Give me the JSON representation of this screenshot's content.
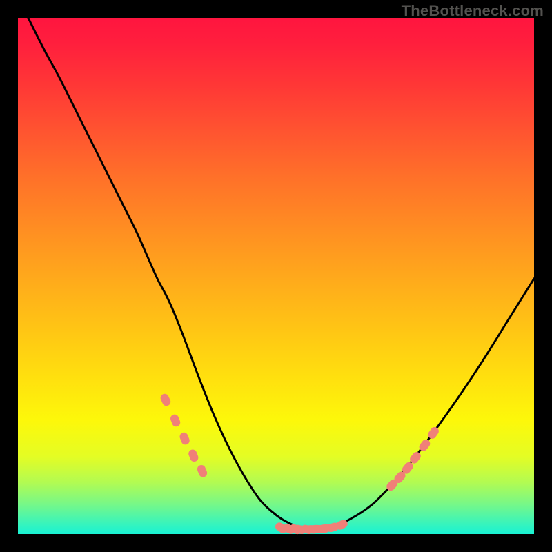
{
  "watermark": "TheBottleneck.com",
  "colors": {
    "background": "#000000",
    "watermark": "#53524f",
    "curve": "#000000",
    "marker_fill": "#f08078",
    "gradient_top": "#ff153f",
    "gradient_bottom": "#18f2d4"
  },
  "chart_data": {
    "type": "line",
    "title": "",
    "xlabel": "",
    "ylabel": "",
    "xlim": [
      0,
      100
    ],
    "ylim": [
      0,
      100
    ],
    "grid": false,
    "legend": false,
    "x": [
      2,
      5,
      8,
      11,
      14,
      17,
      20,
      23,
      25,
      27,
      28.6,
      30,
      32,
      35,
      38,
      41,
      44,
      47,
      50,
      52,
      54,
      56,
      58,
      60,
      62,
      64,
      67,
      70,
      75,
      80,
      85,
      90,
      95,
      100
    ],
    "y": [
      100,
      94,
      88.5,
      82.5,
      76.5,
      70.5,
      64.5,
      58.5,
      54,
      49.5,
      46.5,
      43.5,
      38.5,
      30.5,
      23,
      16.5,
      11,
      6.5,
      3.7,
      2.4,
      1.5,
      1,
      1,
      1.3,
      1.8,
      2.7,
      4.5,
      7,
      12.5,
      19,
      26,
      33.5,
      41.5,
      49.5
    ],
    "overlays": [
      {
        "name": "left-tick-cluster",
        "type": "scatter-rounded",
        "shape": "rounded-rect",
        "x": [
          28.6,
          30.5,
          32.3,
          34.0,
          35.7
        ],
        "y": [
          26.0,
          22.0,
          18.5,
          15.2,
          12.2
        ]
      },
      {
        "name": "bottom-cluster",
        "type": "scatter-rounded",
        "shape": "rounded-rect",
        "x": [
          51.0,
          52.5,
          53.8,
          54.6,
          56.0,
          57.0,
          58.0,
          59.3,
          61.0,
          62.7
        ],
        "y": [
          1.2,
          1.0,
          0.95,
          0.9,
          0.9,
          0.9,
          0.95,
          1.05,
          1.3,
          1.8
        ]
      },
      {
        "name": "right-cluster",
        "type": "scatter-rounded",
        "shape": "rounded-rect",
        "x": [
          72.5,
          74.0,
          75.5,
          77.0,
          78.8,
          80.5
        ],
        "y": [
          9.5,
          11.0,
          12.8,
          14.8,
          17.2,
          19.6
        ]
      }
    ]
  }
}
